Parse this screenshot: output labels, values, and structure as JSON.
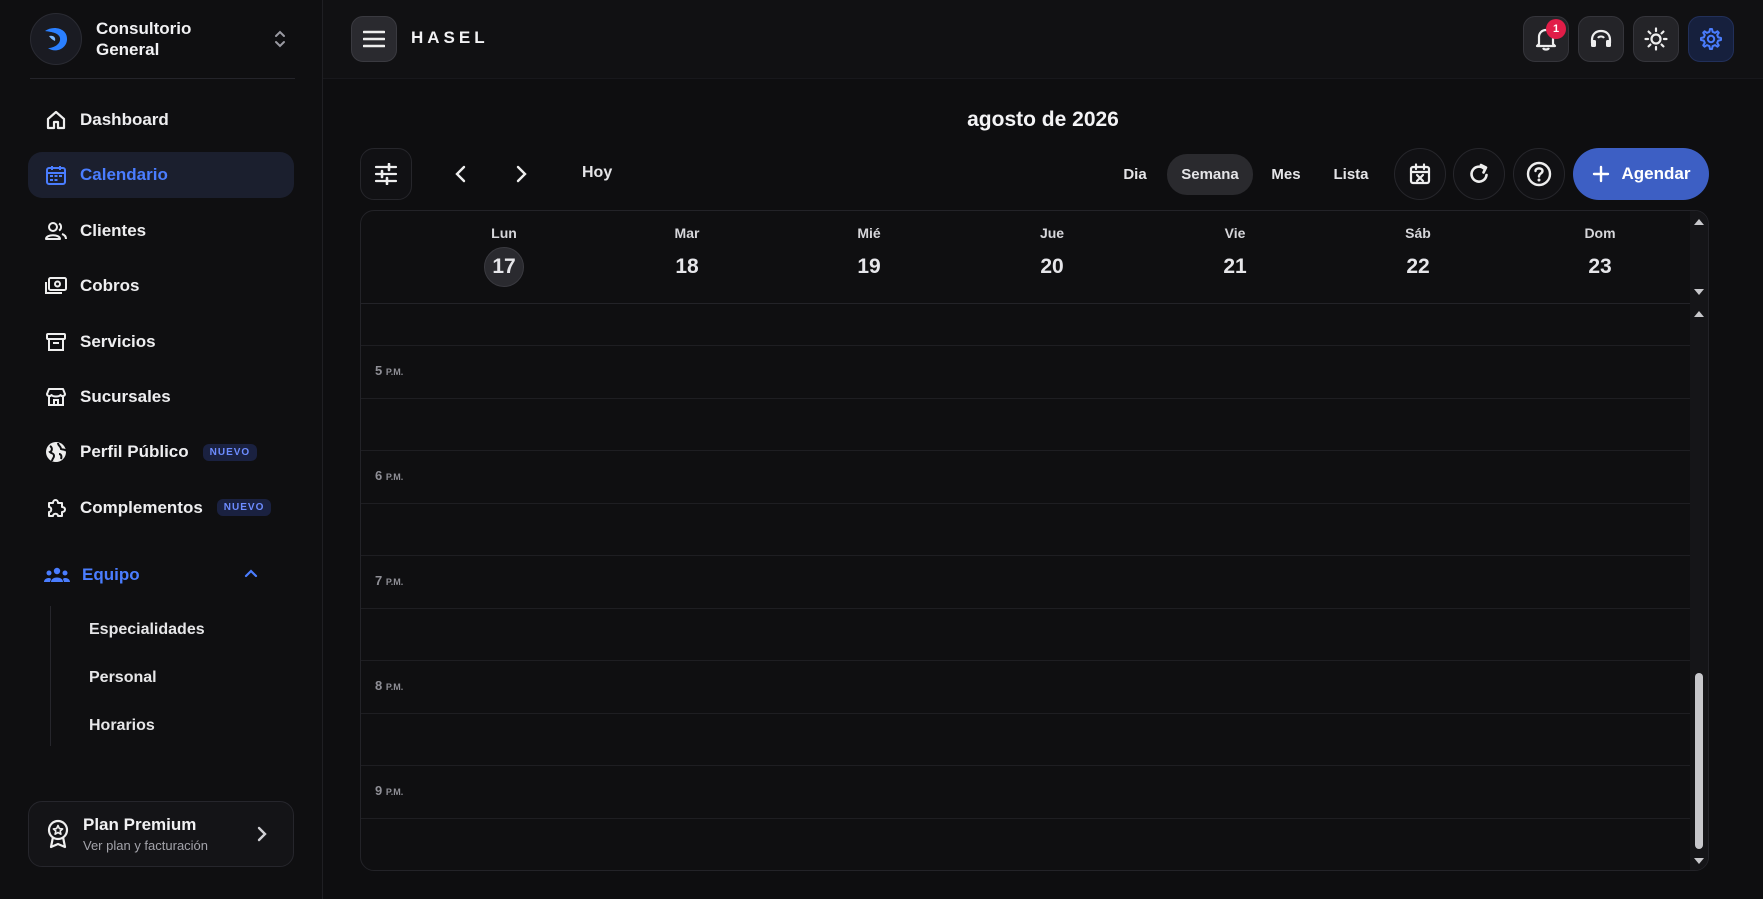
{
  "org": {
    "name": "Consultorio General"
  },
  "nav": [
    {
      "label": "Dashboard",
      "icon": "home-icon"
    },
    {
      "label": "Calendario",
      "icon": "calendar-icon",
      "active": true
    },
    {
      "label": "Clientes",
      "icon": "users-icon"
    },
    {
      "label": "Cobros",
      "icon": "cash-icon"
    },
    {
      "label": "Servicios",
      "icon": "archive-icon"
    },
    {
      "label": "Sucursales",
      "icon": "store-icon"
    },
    {
      "label": "Perfil Público",
      "icon": "globe-icon",
      "badge": "NUEVO"
    },
    {
      "label": "Complementos",
      "icon": "puzzle-icon",
      "badge": "NUEVO"
    }
  ],
  "team": {
    "label": "Equipo",
    "items": [
      "Especialidades",
      "Personal",
      "Horarios"
    ]
  },
  "plan": {
    "title": "Plan Premium",
    "subtitle": "Ver plan y facturación"
  },
  "header": {
    "brand": "HASEL",
    "notifications": "1"
  },
  "calendar": {
    "title": "agosto de 2026",
    "today_label": "Hoy",
    "views": [
      "Dia",
      "Semana",
      "Mes",
      "Lista"
    ],
    "active_view": "Semana",
    "add_label": "Agendar",
    "days": [
      {
        "name": "Lun",
        "num": "17",
        "today": true
      },
      {
        "name": "Mar",
        "num": "18"
      },
      {
        "name": "Mié",
        "num": "19"
      },
      {
        "name": "Jue",
        "num": "20"
      },
      {
        "name": "Vie",
        "num": "21"
      },
      {
        "name": "Sáb",
        "num": "22"
      },
      {
        "name": "Dom",
        "num": "23"
      }
    ],
    "hours": [
      {
        "h": "5",
        "suffix": "P.M."
      },
      {
        "h": "6",
        "suffix": "P.M."
      },
      {
        "h": "7",
        "suffix": "P.M."
      },
      {
        "h": "8",
        "suffix": "P.M."
      },
      {
        "h": "9",
        "suffix": "P.M."
      }
    ]
  },
  "colors": {
    "accent": "#4a7dff",
    "primary_button": "#3d5fc4",
    "badge": "#e11d48"
  }
}
